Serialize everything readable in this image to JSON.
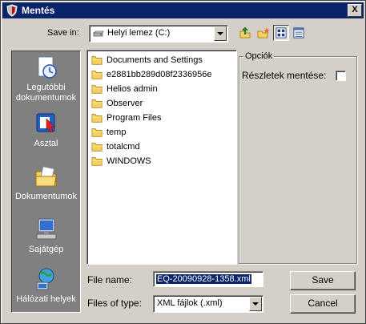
{
  "window": {
    "title": "Mentés",
    "close_glyph": "X"
  },
  "save_in": {
    "label": "Save in:",
    "value": "Helyi lemez (C:)"
  },
  "toolbar": {
    "buttons": [
      "up-folder-icon",
      "new-folder-icon",
      "list-view-icon",
      "details-view-icon"
    ]
  },
  "places": [
    {
      "label": "Legutóbbi dokumentumok",
      "icon": "recent-documents-icon"
    },
    {
      "label": "Asztal",
      "icon": "desktop-icon"
    },
    {
      "label": "Dokumentumok",
      "icon": "documents-icon"
    },
    {
      "label": "Sajátgép",
      "icon": "my-computer-icon"
    },
    {
      "label": "Hálózati helyek",
      "icon": "network-icon"
    }
  ],
  "files": [
    "Documents and Settings",
    "e2881bb289d08f2336956e",
    "Helios admin",
    "Observer",
    "Program Files",
    "temp",
    "totalcmd",
    "WINDOWS"
  ],
  "options": {
    "legend": "Opciók",
    "details_label": "Részletek mentése:"
  },
  "file_name": {
    "label": "File name:",
    "value": "EQ-20090928-1358.xml"
  },
  "file_type": {
    "label": "Files of type:",
    "value": "XML fájlok (.xml)"
  },
  "buttons": {
    "save": "Save",
    "cancel": "Cancel"
  },
  "colors": {
    "title_bar": "#0a246a",
    "dialog_bg": "#d4d0c8",
    "sidebar_bg": "#808080",
    "folder": "#f5d063"
  }
}
